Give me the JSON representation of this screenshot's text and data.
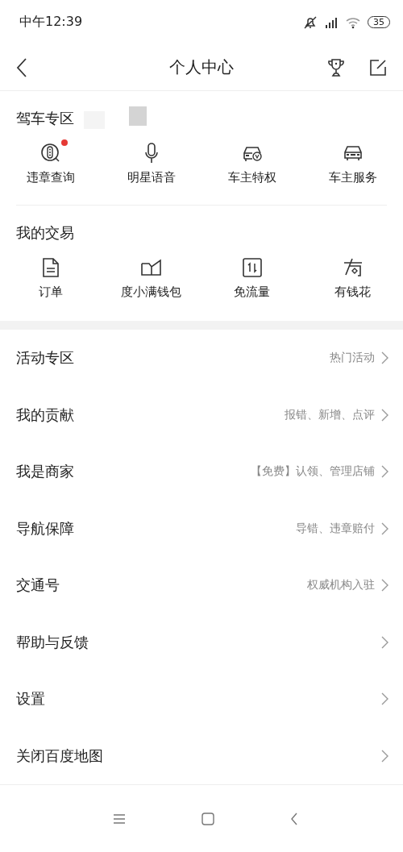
{
  "status_bar": {
    "time": "中午12:39",
    "battery": "35"
  },
  "header": {
    "title": "个人中心"
  },
  "driving": {
    "title": "驾车专区",
    "items": [
      {
        "label": "违章查询",
        "badge": true
      },
      {
        "label": "明星语音",
        "badge": false
      },
      {
        "label": "车主特权",
        "badge": false
      },
      {
        "label": "车主服务",
        "badge": false
      }
    ]
  },
  "trade": {
    "title": "我的交易",
    "items": [
      {
        "label": "订单",
        "badge": false
      },
      {
        "label": "度小满钱包",
        "badge": false
      },
      {
        "label": "免流量",
        "badge": false
      },
      {
        "label": "有钱花",
        "badge": false
      }
    ]
  },
  "menu": [
    {
      "label": "活动专区",
      "hint": "热门活动"
    },
    {
      "label": "我的贡献",
      "hint": "报错、新增、点评"
    },
    {
      "label": "我是商家",
      "hint": "【免费】认领、管理店铺"
    },
    {
      "label": "导航保障",
      "hint": "导错、违章赔付"
    },
    {
      "label": "交通号",
      "hint": "权威机构入驻"
    },
    {
      "label": "帮助与反馈"
    },
    {
      "label": "设置"
    },
    {
      "label": "关闭百度地图"
    }
  ]
}
